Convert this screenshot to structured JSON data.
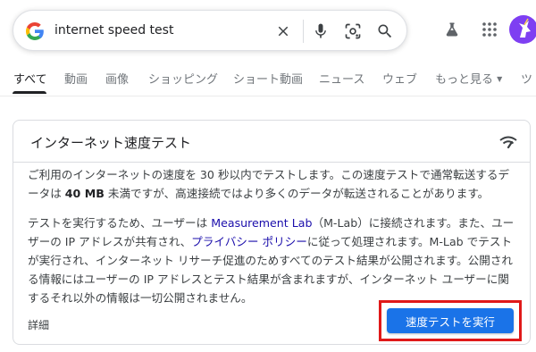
{
  "search": {
    "query": "internet speed test"
  },
  "tabs": [
    {
      "label": "すべて"
    },
    {
      "label": "動画"
    },
    {
      "label": "画像"
    },
    {
      "label": "ショッピング"
    },
    {
      "label": "ショート動画"
    },
    {
      "label": "ニュース"
    },
    {
      "label": "ウェブ"
    },
    {
      "label": "もっと見る"
    },
    {
      "label": "ツ"
    }
  ],
  "card": {
    "title": "インターネット速度テスト",
    "para1": {
      "a": "ご利用のインターネットの速度を 30 秒以内でテストします。この速度テストで通常転送するデータは ",
      "b": "40 MB",
      "c": " 未満ですが、高速接続ではより多くのデータが転送されることがあります。"
    },
    "para2": {
      "a": "テストを実行するため、ユーザーは ",
      "link1": "Measurement Lab",
      "b": "（M-Lab）に接続されます。また、ユーザーの IP アドレスが共有され、",
      "link2": "プライバシー ポリシー",
      "c": "に従って処理されます。M-Lab でテストが実行され、インターネット リサーチ促進のためすべてのテスト結果が公開されます。公開される情報にはユーザーの IP アドレスとテスト結果が含まれますが、インターネット ユーザーに関するそれ以外の情報は一切公開されません。"
    },
    "details_label": "詳細",
    "run_button_label": "速度テストを実行"
  },
  "colors": {
    "accent": "#1a73e8",
    "link": "#1a0dab",
    "highlight_border": "#e01919",
    "avatar_bg": "#7e3ff2"
  },
  "icons": [
    "google-g-icon",
    "clear-icon",
    "microphone-icon",
    "lens-icon",
    "search-icon",
    "labs-flask-icon",
    "apps-grid-icon",
    "wifi-icon",
    "chevron-down-icon"
  ]
}
